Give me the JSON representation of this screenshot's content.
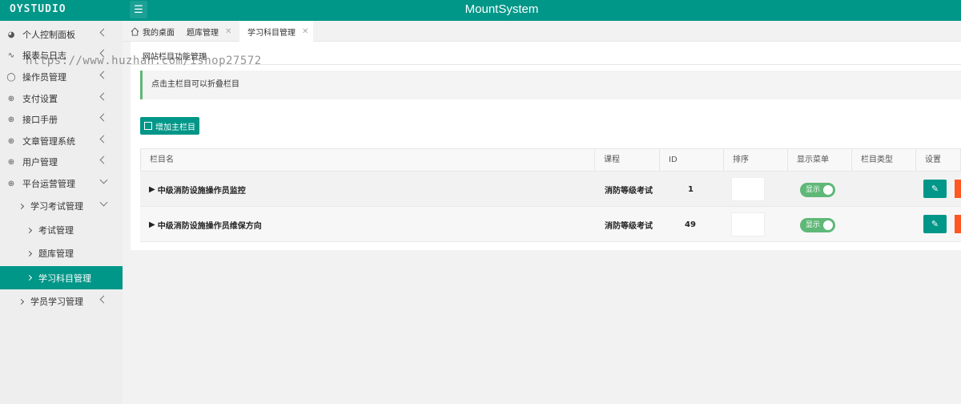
{
  "header": {
    "logo": "OYSTUDIO",
    "app_title": "MountSystem"
  },
  "sidebar": {
    "items": [
      {
        "label": "个人控制面板"
      },
      {
        "label": "报表与日志"
      },
      {
        "label": "操作员管理"
      },
      {
        "label": "支付设置"
      },
      {
        "label": "接口手册"
      },
      {
        "label": "文章管理系统"
      },
      {
        "label": "用户管理"
      },
      {
        "label": "平台运营管理"
      },
      {
        "label": "学习考试管理"
      },
      {
        "label": "考试管理"
      },
      {
        "label": "题库管理"
      },
      {
        "label": "学习科目管理"
      },
      {
        "label": "学员学习管理"
      }
    ]
  },
  "tabs": [
    {
      "label": "我的桌面"
    },
    {
      "label": "题库管理"
    },
    {
      "label": "学习科目管理"
    }
  ],
  "watermark": "https://www.huzhan.com/ishop27572",
  "breadcrumb": "网站栏目功能管理",
  "notice": "点击主栏目可以折叠栏目",
  "add_button": "增加主栏目",
  "table": {
    "headers": [
      "栏目名",
      "课程",
      "ID",
      "排序",
      "显示菜单",
      "栏目类型",
      "设置"
    ],
    "rows": [
      {
        "name": "中级消防设施操作员监控",
        "course": "消防等级考试",
        "id": "1",
        "sort": "",
        "show": "显示"
      },
      {
        "name": "中级消防设施操作员维保方向",
        "course": "消防等级考试",
        "id": "49",
        "sort": "",
        "show": "显示"
      }
    ]
  },
  "colors": {
    "accent": "#009688",
    "switch_on": "#5fb878",
    "danger": "#ff5722"
  }
}
